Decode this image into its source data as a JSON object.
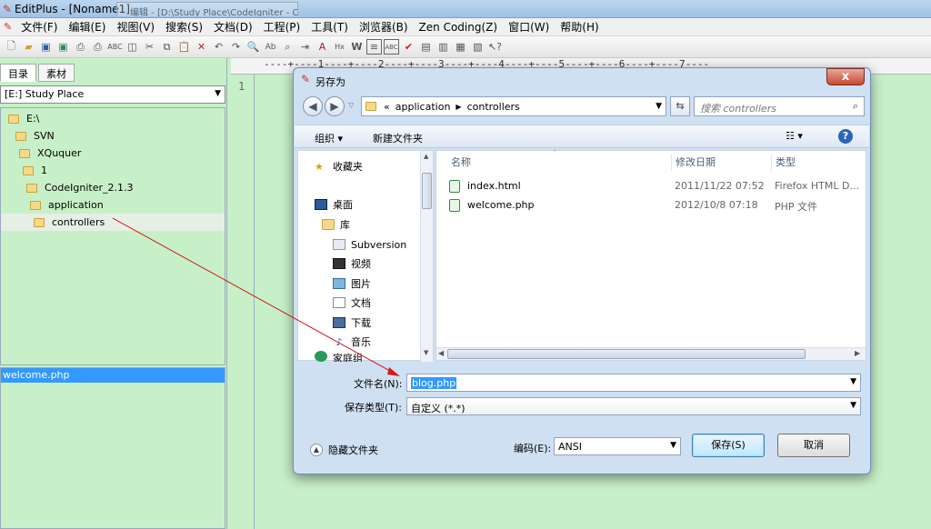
{
  "app": {
    "title": "EditPlus - [Noname1]",
    "tab_ghost": "编辑 - [D:\\Study Place\\CodeIgniter - Co..."
  },
  "menu": [
    "文件(F)",
    "编辑(E)",
    "视图(V)",
    "搜索(S)",
    "文档(D)",
    "工程(P)",
    "工具(T)",
    "浏览器(B)",
    "Zen Coding(Z)",
    "窗口(W)",
    "帮助(H)"
  ],
  "left_panel": {
    "tabs": [
      "目录",
      "素材"
    ],
    "directory": "[E:] Study Place",
    "tree": [
      {
        "label": "E:\\",
        "depth": 0
      },
      {
        "label": "SVN",
        "depth": 1
      },
      {
        "label": "XQuquer",
        "depth": 2
      },
      {
        "label": "1",
        "depth": 3
      },
      {
        "label": "CodeIgniter_2.1.3",
        "depth": 4
      },
      {
        "label": "application",
        "depth": 5
      },
      {
        "label": "controllers",
        "depth": 6
      }
    ],
    "files": [
      "welcome.php"
    ]
  },
  "editor": {
    "ruler": "----+----1----+----2----+----3----+----4----+----5----+----6----+----7----",
    "line_number": "1"
  },
  "dialog": {
    "title": "另存为",
    "close": "x",
    "address": {
      "prefix": "«",
      "crumbs": [
        "application",
        "controllers"
      ]
    },
    "search_placeholder": "搜索 controllers",
    "commands": {
      "organize": "组织 ▾",
      "new_folder": "新建文件夹"
    },
    "nav_items": [
      {
        "label": "收藏夹",
        "icon": "star-icon",
        "indent": 0
      },
      {
        "label": "桌面",
        "icon": "desktop-icon",
        "indent": 0
      },
      {
        "label": "库",
        "icon": "library-icon",
        "indent": 1
      },
      {
        "label": "Subversion",
        "icon": "folder-icon",
        "indent": 2
      },
      {
        "label": "视频",
        "icon": "video-icon",
        "indent": 2
      },
      {
        "label": "图片",
        "icon": "picture-icon",
        "indent": 2
      },
      {
        "label": "文档",
        "icon": "document-icon",
        "indent": 2
      },
      {
        "label": "下载",
        "icon": "download-icon",
        "indent": 2
      },
      {
        "label": "音乐",
        "icon": "music-icon",
        "indent": 2
      },
      {
        "label": "家庭组",
        "icon": "homegroup-icon",
        "indent": 0
      }
    ],
    "columns": [
      "名称",
      "修改日期",
      "类型"
    ],
    "files": [
      {
        "name": "index.html",
        "date": "2011/11/22 07:52",
        "type": "Firefox HTML D..."
      },
      {
        "name": "welcome.php",
        "date": "2012/10/8 07:18",
        "type": "PHP 文件"
      }
    ],
    "filename_label": "文件名(N):",
    "filename_value": "blog.php",
    "filetype_label": "保存类型(T):",
    "filetype_value": "自定义 (*.*)",
    "encoding_label": "编码(E):",
    "encoding_value": "ANSI",
    "save_label": "保存(S)",
    "cancel_label": "取消",
    "hide_folders": "隐藏文件夹"
  },
  "colors": {
    "editor_bg": "#c8f0c8",
    "selection": "#3399ff",
    "annotation_arrow": "#d11a1a"
  }
}
